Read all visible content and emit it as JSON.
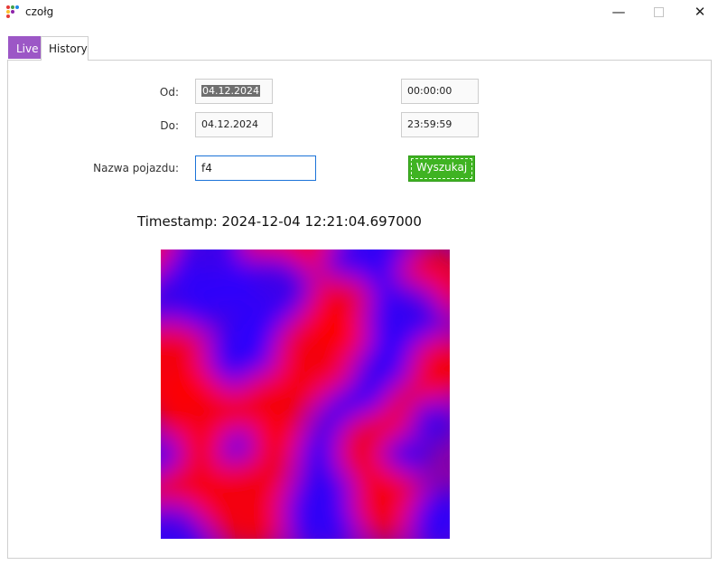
{
  "window": {
    "title": "czołg",
    "minimize": "—",
    "close": "✕"
  },
  "tabs": [
    {
      "label": "Live",
      "active": false
    },
    {
      "label": "History",
      "active": true
    }
  ],
  "form": {
    "from_label": "Od:",
    "from_date": "04.12.2024",
    "from_time": "00:00:00",
    "to_label": "Do:",
    "to_date": "04.12.2024",
    "to_time": "23:59:59",
    "vehicle_label": "Nazwa pojazdu:",
    "vehicle_value": "f4",
    "search_label": "Wyszukaj"
  },
  "result": {
    "timestamp": "Timestamp: 2024-12-04 12:21:04.697000",
    "heatmap_colors": {
      "low": "#2a00ff",
      "high": "#ff0000"
    }
  },
  "colors": {
    "tab_accent": "#9c57c6",
    "search_button": "#3fb322",
    "focus_border": "#1b73d8"
  }
}
